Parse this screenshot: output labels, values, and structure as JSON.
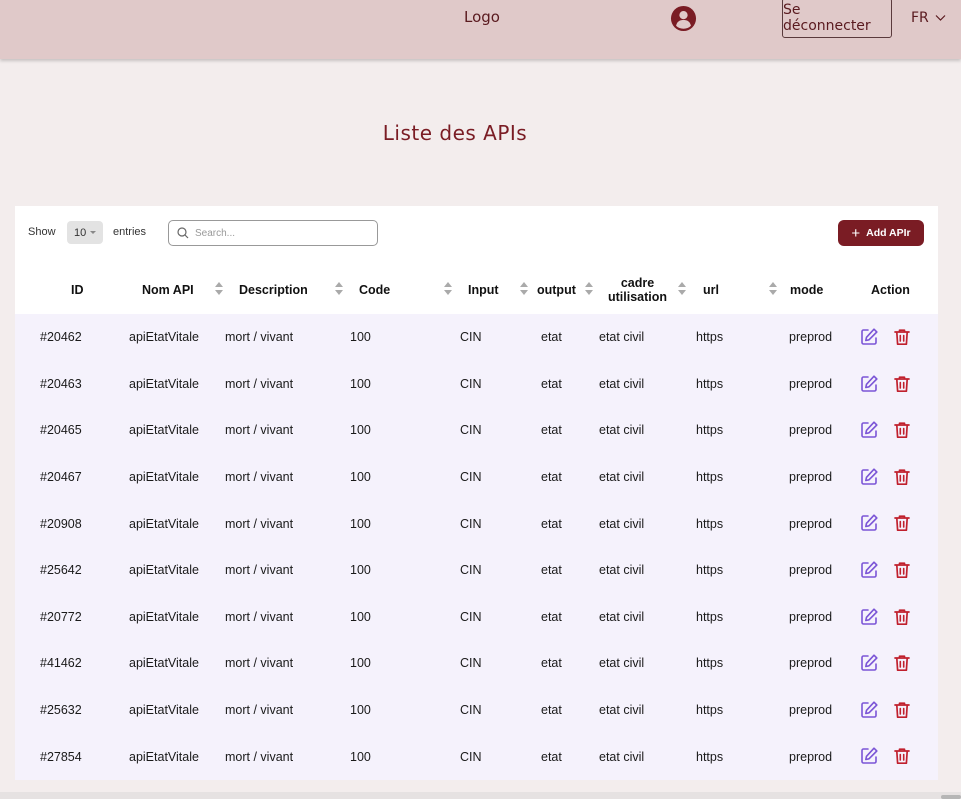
{
  "header": {
    "logo": "Logo",
    "logout": "Se déconnecter",
    "language": "FR",
    "icons": {
      "user": "user-circle-icon",
      "lang_caret": "chevron-down-icon"
    }
  },
  "page": {
    "title": "Liste des APIs"
  },
  "controls": {
    "show": "Show",
    "entries_value": "10",
    "entries": "entries",
    "search_placeholder": "Search...",
    "add": "Add APIr"
  },
  "colors": {
    "brand": "#7a1c24",
    "header_bg": "#e0c9c9",
    "page_bg": "#f3eded",
    "rows_bg": "#f5f2fc",
    "edit_icon": "#7b55d6",
    "delete_icon": "#c0202d"
  },
  "table": {
    "headers": {
      "id": "ID",
      "nom": "Nom API",
      "description": "Description",
      "code": "Code",
      "input": "Input",
      "output": "output",
      "cadre_1": "cadre",
      "cadre_2": "utilisation",
      "url": "url",
      "mode": "mode",
      "action": "Action"
    },
    "rows": [
      {
        "id": "#20462",
        "nom": "apiEtatVitale",
        "description": "mort / vivant",
        "code": "100",
        "input": "CIN",
        "output": "etat",
        "cadre": "etat civil",
        "url": "https",
        "mode": "preprod"
      },
      {
        "id": "#20463",
        "nom": "apiEtatVitale",
        "description": "mort / vivant",
        "code": "100",
        "input": "CIN",
        "output": "etat",
        "cadre": "etat civil",
        "url": "https",
        "mode": "preprod"
      },
      {
        "id": "#20465",
        "nom": "apiEtatVitale",
        "description": "mort / vivant",
        "code": "100",
        "input": "CIN",
        "output": "etat",
        "cadre": "etat civil",
        "url": "https",
        "mode": "preprod"
      },
      {
        "id": "#20467",
        "nom": "apiEtatVitale",
        "description": "mort / vivant",
        "code": "100",
        "input": "CIN",
        "output": "etat",
        "cadre": "etat civil",
        "url": "https",
        "mode": "preprod"
      },
      {
        "id": "#20908",
        "nom": "apiEtatVitale",
        "description": "mort / vivant",
        "code": "100",
        "input": "CIN",
        "output": "etat",
        "cadre": "etat civil",
        "url": "https",
        "mode": "preprod"
      },
      {
        "id": "#25642",
        "nom": "apiEtatVitale",
        "description": "mort / vivant",
        "code": "100",
        "input": "CIN",
        "output": "etat",
        "cadre": "etat civil",
        "url": "https",
        "mode": "preprod"
      },
      {
        "id": "#20772",
        "nom": "apiEtatVitale",
        "description": "mort / vivant",
        "code": "100",
        "input": "CIN",
        "output": "etat",
        "cadre": "etat civil",
        "url": "https",
        "mode": "preprod"
      },
      {
        "id": "#41462",
        "nom": "apiEtatVitale",
        "description": "mort / vivant",
        "code": "100",
        "input": "CIN",
        "output": "etat",
        "cadre": "etat civil",
        "url": "https",
        "mode": "preprod"
      },
      {
        "id": "#25632",
        "nom": "apiEtatVitale",
        "description": "mort / vivant",
        "code": "100",
        "input": "CIN",
        "output": "etat",
        "cadre": "etat civil",
        "url": "https",
        "mode": "preprod"
      },
      {
        "id": "#27854",
        "nom": "apiEtatVitale",
        "description": "mort / vivant",
        "code": "100",
        "input": "CIN",
        "output": "etat",
        "cadre": "etat civil",
        "url": "https",
        "mode": "preprod"
      }
    ],
    "row_icons": {
      "edit": "edit-icon",
      "delete": "trash-icon"
    }
  }
}
